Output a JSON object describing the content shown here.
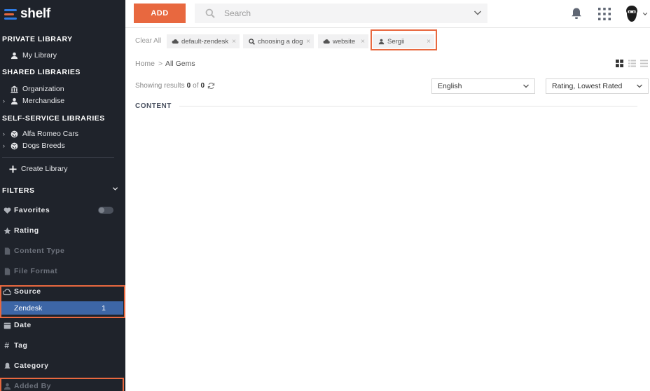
{
  "app": {
    "logo_text": "shelf"
  },
  "sidebar": {
    "private_title": "PRIVATE LIBRARY",
    "private_items": [
      {
        "label": "My Library",
        "icon": "user-library-icon"
      }
    ],
    "shared_title": "SHARED LIBRARIES",
    "shared_items": [
      {
        "label": "Organization",
        "icon": "bank-icon"
      },
      {
        "label": "Merchandise",
        "icon": "user-group-icon"
      }
    ],
    "self_service_title": "SELF-SERVICE LIBRARIES",
    "self_service_items": [
      {
        "label": "Alfa Romeo Cars",
        "icon": "globe-icon"
      },
      {
        "label": "Dogs Breeds",
        "icon": "globe-icon"
      }
    ],
    "create_library": "Create Library",
    "filters_title": "FILTERS",
    "filters": {
      "favorites": "Favorites",
      "rating": "Rating",
      "content_type": "Content Type",
      "file_format": "File Format",
      "source": "Source",
      "date": "Date",
      "tag": "Tag",
      "category": "Category",
      "added_by": "Added By"
    },
    "source_option": {
      "label": "Zendesk",
      "count": "1"
    }
  },
  "topbar": {
    "add_label": "ADD",
    "search_placeholder": "Search"
  },
  "tags": {
    "clear_all": "Clear All",
    "items": [
      {
        "label": "default-zendesk",
        "icon": "cloud-icon"
      },
      {
        "label": "choosing a dog",
        "icon": "search-icon"
      },
      {
        "label": "website",
        "icon": "cloud-icon"
      },
      {
        "label": "Sergii",
        "icon": "user-icon"
      }
    ]
  },
  "breadcrumb": {
    "home": "Home",
    "separator": ">",
    "current": "All Gems"
  },
  "results": {
    "prefix": "Showing results",
    "from": "0",
    "of": "of",
    "total": "0"
  },
  "language_select": {
    "value": "English"
  },
  "sort_select": {
    "value": "Rating, Lowest Rated"
  },
  "content_label": "CONTENT",
  "colors": {
    "accent": "#e8683f",
    "sidebar_bg": "#1f232b",
    "selected_bg": "#3d66a6",
    "brand_blue": "#2f7be4"
  }
}
